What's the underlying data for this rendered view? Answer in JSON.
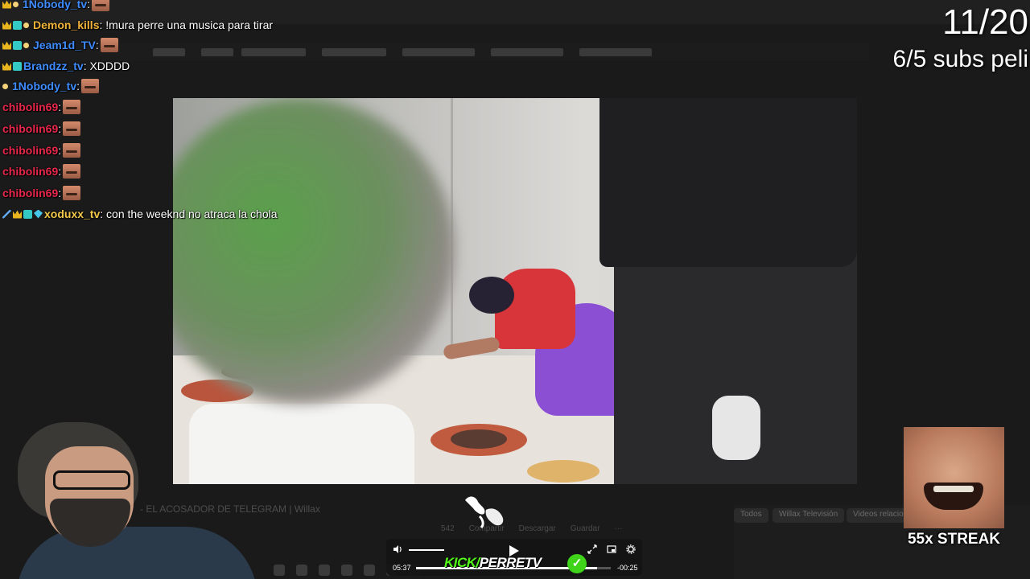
{
  "chat": [
    {
      "badges": [
        "crown",
        "dot"
      ],
      "user": "1Nobody_tv",
      "color": "#3f8cff",
      "sep": ":",
      "msg": "",
      "emote": true
    },
    {
      "badges": [
        "crown",
        "grid",
        "dot"
      ],
      "user": "Demon_kills",
      "color": "#f2b43a",
      "sep": ":",
      "msg": " !mura perre una musica para tirar",
      "emote": false
    },
    {
      "badges": [
        "crown",
        "grid",
        "dot"
      ],
      "user": "Jeam1d_TV",
      "color": "#3f8cff",
      "sep": ":",
      "msg": "",
      "emote": true
    },
    {
      "badges": [
        "crown",
        "grid"
      ],
      "user": "Brandzz_tv",
      "color": "#3f8cff",
      "sep": ":",
      "msg": " XDDDD",
      "emote": false
    },
    {
      "badges": [
        "dot"
      ],
      "user": "1Nobody_tv",
      "color": "#3f8cff",
      "sep": ":",
      "msg": "",
      "emote": true
    },
    {
      "badges": [],
      "user": "chibolin69",
      "color": "#e8274b",
      "sep": ":",
      "msg": "",
      "emote": true
    },
    {
      "badges": [],
      "user": "chibolin69",
      "color": "#e8274b",
      "sep": ":",
      "msg": "",
      "emote": true
    },
    {
      "badges": [],
      "user": "chibolin69",
      "color": "#e8274b",
      "sep": ":",
      "msg": "",
      "emote": true
    },
    {
      "badges": [],
      "user": "chibolin69",
      "color": "#e8274b",
      "sep": ":",
      "msg": "",
      "emote": true
    },
    {
      "badges": [],
      "user": "chibolin69",
      "color": "#e8274b",
      "sep": ":",
      "msg": "",
      "emote": true
    },
    {
      "badges": [
        "sword",
        "crown",
        "grid",
        "gem"
      ],
      "user": "xoduxx_tv",
      "color": "#f2c84a",
      "sep": ":",
      "msg": " con the weeknd no atraca la chola",
      "emote": false
    }
  ],
  "overlay": {
    "counter": "11/20",
    "subs": "6/5 subs peli",
    "streak": "55x STREAK"
  },
  "background_page": {
    "video_title": "- EL ACOSADOR DE TELEGRAM | Willax",
    "chips": [
      "Todos",
      "Willax Televisión",
      "Videos relacionados"
    ],
    "actions": [
      "542",
      "Compartir",
      "Descargar",
      "Guardar",
      "···"
    ]
  },
  "player": {
    "current_time": "05:37",
    "remaining_time": "-00:25",
    "progress": 0.93,
    "volume": 0.55,
    "brand": "KICK/",
    "channel": "PERRETV",
    "verified_icon": "checkmark-icon"
  },
  "icons": {
    "volume": "volume-icon",
    "play": "play-icon",
    "expand": "expand-icon",
    "pip": "pip-icon",
    "settings": "gear-icon"
  },
  "colors": {
    "kick_green": "#53fc18",
    "chat_red": "#e8274b",
    "chat_blue": "#3f8cff"
  }
}
